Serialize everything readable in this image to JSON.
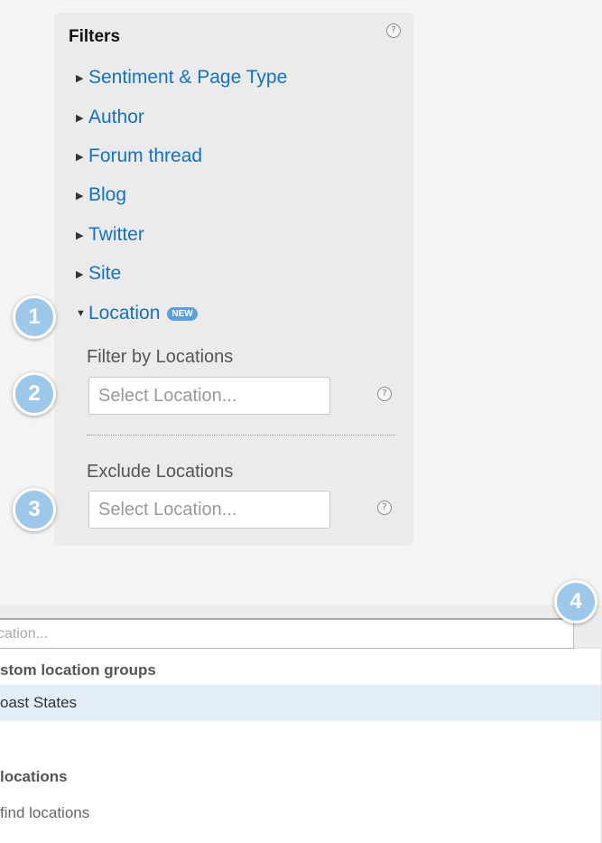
{
  "filters": {
    "title": "Filters",
    "help_glyph": "?",
    "items": [
      {
        "label": "Sentiment & Page Type",
        "expanded": false
      },
      {
        "label": "Author",
        "expanded": false
      },
      {
        "label": "Forum thread",
        "expanded": false
      },
      {
        "label": "Blog",
        "expanded": false
      },
      {
        "label": "Twitter",
        "expanded": false
      },
      {
        "label": "Site",
        "expanded": false
      },
      {
        "label": "Location",
        "expanded": true,
        "badge": "NEW"
      }
    ],
    "location": {
      "filter_label": "Filter by Locations",
      "filter_placeholder": "Select Location...",
      "exclude_label": "Exclude Locations",
      "exclude_placeholder": "Select Location..."
    }
  },
  "steps": [
    "1",
    "2",
    "3",
    "4"
  ],
  "dropdown": {
    "input_placeholder": "cation...",
    "group_header": "stom location groups",
    "selected_option": "oast States",
    "locations_header": "locations",
    "hint": "find locations"
  },
  "colors": {
    "link": "#1570c8",
    "badge": "#5ba0de",
    "step_badge": "#9dc8ea",
    "highlight_row": "#e4eef9"
  },
  "icons": {
    "collapsed": "triangle-right-icon",
    "expanded": "triangle-down-icon",
    "help": "help-icon"
  }
}
